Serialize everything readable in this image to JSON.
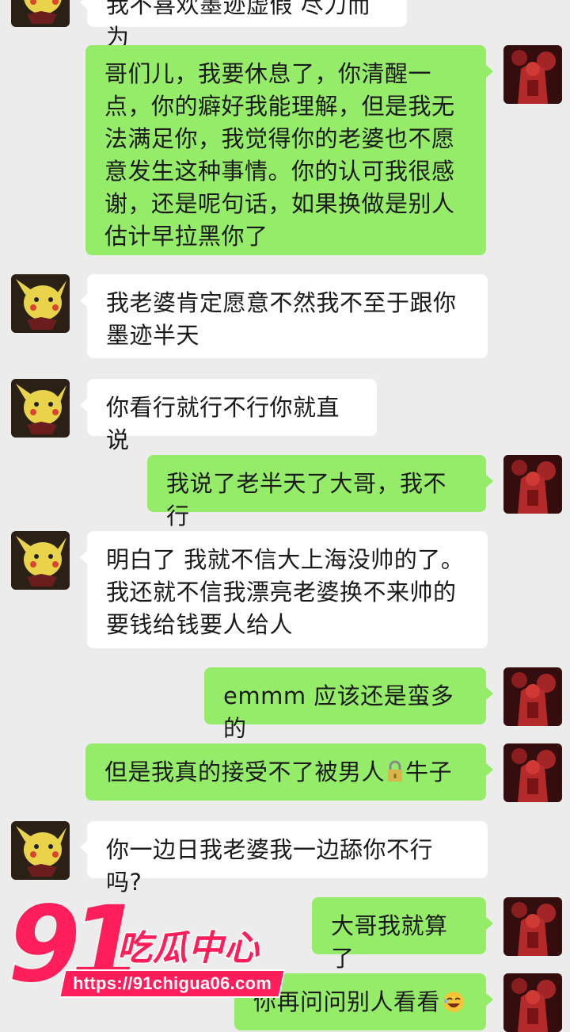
{
  "colors": {
    "background": "#ececec",
    "incoming_bubble": "#ffffff",
    "outgoing_bubble": "#95ec69",
    "watermark": "#ff1e5a"
  },
  "messages": [
    {
      "side": "in",
      "text": "我不喜欢墨迹虚假 尽力而为",
      "partial": true
    },
    {
      "side": "out",
      "text": "哥们儿，我要休息了，你清醒一点，你的癖好我能理解，但是我无法满足你，我觉得你的老婆也不愿意发生这种事情。你的认可我很感谢，还是呢句话，如果换做是别人估计早拉黑你了"
    },
    {
      "side": "in",
      "text": "我老婆肯定愿意不然我不至于跟你墨迹半天"
    },
    {
      "side": "in",
      "text": "你看行就行不行你就直说"
    },
    {
      "side": "out",
      "text": "我说了老半天了大哥，我不行"
    },
    {
      "side": "in",
      "text": "明白了 我就不信大上海没帅的了。我还就不信我漂亮老婆换不来帅的 要钱给钱要人给人"
    },
    {
      "side": "out",
      "text": "emmm 应该还是蛮多的"
    },
    {
      "side": "out",
      "text_before": "但是我真的接受不了被男人",
      "icon": "lock-icon",
      "text_after": "牛子"
    },
    {
      "side": "in",
      "text": "你一边日我老婆我一边舔你不行吗?"
    },
    {
      "side": "out",
      "text": "大哥我就算了"
    },
    {
      "side": "out",
      "text": "你再问问别人看看",
      "icon": "laughing-emoji-icon",
      "partial": true
    }
  ],
  "watermark": {
    "number": "91",
    "name": "吃瓜中心",
    "url": "https://91chigua06.com"
  }
}
